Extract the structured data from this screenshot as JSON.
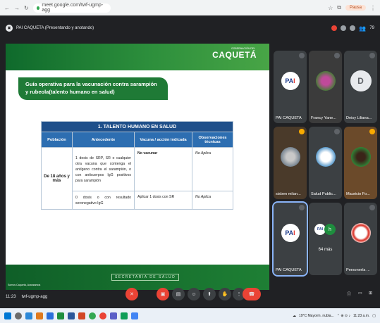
{
  "browser": {
    "url": "meet.google.com/twf-ugmp-agg",
    "profile_label": "Pausa"
  },
  "meet": {
    "presenter_title": "PAI CAQUETA (Presentando y anotando)",
    "people_count": "79",
    "meeting_time": "11:23",
    "meeting_code": "twf-ugmp-agg"
  },
  "slide": {
    "logo_sub": "GOBERNACIÓN DEL",
    "logo": "CAQUETÁ",
    "guide_title": "Guía operativa para la vacunación contra sarampión y rubeola(talento humano en salud)",
    "table_title": "1. TALENTO HUMANO EN SALUD",
    "columns": [
      "Población",
      "Antecedente",
      "Vacuna / acción indicada",
      "Observaciones técnicas"
    ],
    "population": "De 18 años y más",
    "rows": [
      {
        "antecedente": "1 dosis de SRP, SR o cualquier otra vacuna que contenga el antígeno contra el sarampión, o con anticuerpos IgG positivos para sarampión",
        "vacuna": "No vacunar",
        "observaciones": "No Aplica"
      },
      {
        "antecedente": "0 dosis o con resultado seronegativo IgG",
        "vacuna": "Aplicar 1 dosis con SR",
        "observaciones": "No Aplica"
      }
    ],
    "footer_caption": "SECRETARIA DE SALUD",
    "footer_left": "Somos Caquetá, Avanzamos"
  },
  "participants": [
    {
      "name": "PAI CAQUETA"
    },
    {
      "name": "Francy Yane..."
    },
    {
      "name": "Deisy Liliana..."
    },
    {
      "name": "sisben milan..."
    },
    {
      "name": "Salud Public..."
    },
    {
      "name": "Mauricio Fo..."
    },
    {
      "name": "PAI CAQUETA"
    },
    {
      "name": "64 más"
    },
    {
      "name": "Personería ..."
    }
  ],
  "avatar_letters": {
    "deisy": "D",
    "more": "h"
  },
  "taskbar": {
    "weather": "19°C Mayorm. nubla...",
    "time": "11:23 a.m."
  },
  "colors": {
    "slide_green": "#1f7a36",
    "table_blue": "#2d6eb1",
    "hangup_red": "#ea4335",
    "meet_bg": "#202124"
  }
}
